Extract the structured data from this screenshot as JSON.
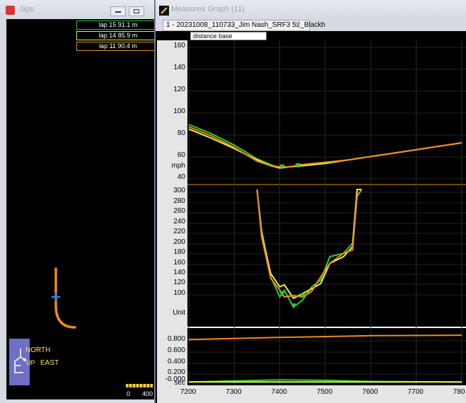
{
  "gps": {
    "title": "Gps",
    "laps": [
      {
        "label": "lap 15 91.1 m",
        "color": "#2ecc2e"
      },
      {
        "label": "lap 14 85.9 m",
        "color": "#e6f04a"
      },
      {
        "label": "lap 11 90.4 m",
        "color": "#f08a1c"
      }
    ],
    "compass": {
      "north": "NORTH",
      "east": "EAST",
      "up": "UP"
    },
    "scale": {
      "start": "0",
      "end": "400"
    }
  },
  "measures": {
    "title": "Measures Graph (11)",
    "tab_label": "1 - 20231008_110733_Jim Nash_SRF3 52_Blackh",
    "tab_close": "✕",
    "distance_label": "distance base"
  },
  "chart_data": [
    {
      "type": "line",
      "ylabel": "mph",
      "ylim": [
        40,
        160
      ],
      "yticks": [
        "160",
        "140",
        "120",
        "100",
        "80",
        "60",
        "40"
      ],
      "series": [
        {
          "name": "lap 15",
          "color": "#2ecc2e",
          "x": [
            7200,
            7250,
            7300,
            7350,
            7380,
            7400,
            7420,
            7450,
            7500,
            7550,
            7600,
            7650,
            7700,
            7750,
            7800
          ],
          "y": [
            90,
            82,
            72,
            60,
            55,
            52,
            53,
            54,
            56,
            59,
            62,
            65,
            68,
            71,
            74
          ]
        },
        {
          "name": "lap 14",
          "color": "#e6f04a",
          "x": [
            7200,
            7250,
            7300,
            7350,
            7380,
            7400,
            7420,
            7450,
            7500,
            7550,
            7600,
            7650,
            7700,
            7750,
            7800
          ],
          "y": [
            86,
            78,
            69,
            59,
            54,
            52,
            53,
            54,
            56,
            59,
            62,
            65,
            68,
            71,
            74
          ]
        },
        {
          "name": "lap 11",
          "color": "#f08a1c",
          "x": [
            7200,
            7250,
            7300,
            7350,
            7380,
            7400,
            7420,
            7450,
            7500,
            7550,
            7600,
            7650,
            7700,
            7750,
            7800
          ],
          "y": [
            88,
            80,
            70,
            58,
            54,
            53,
            53,
            55,
            57,
            59,
            62,
            65,
            68,
            71,
            74
          ]
        }
      ]
    },
    {
      "type": "line",
      "ylabel": "Unit",
      "ylim": [
        100,
        300
      ],
      "yticks": [
        "300",
        "280",
        "260",
        "240",
        "220",
        "200",
        "180",
        "160",
        "140",
        "120",
        "100"
      ],
      "series": [
        {
          "name": "lap 15",
          "color": "#2ecc2e",
          "x": [
            7350,
            7360,
            7380,
            7400,
            7410,
            7430,
            7450,
            7470,
            7490,
            7510,
            7540,
            7560,
            7570,
            7580
          ],
          "y": [
            300,
            240,
            170,
            140,
            150,
            125,
            135,
            155,
            165,
            200,
            205,
            220,
            300,
            300
          ]
        },
        {
          "name": "lap 14",
          "color": "#e6f04a",
          "x": [
            7350,
            7360,
            7380,
            7400,
            7410,
            7430,
            7450,
            7470,
            7490,
            7510,
            7540,
            7560,
            7570,
            7580
          ],
          "y": [
            300,
            235,
            175,
            155,
            158,
            138,
            145,
            152,
            160,
            190,
            200,
            215,
            300,
            300
          ]
        },
        {
          "name": "lap 11",
          "color": "#f08a1c",
          "x": [
            7350,
            7360,
            7380,
            7400,
            7410,
            7430,
            7450,
            7470,
            7490,
            7510,
            7540,
            7560,
            7570,
            7580
          ],
          "y": [
            300,
            230,
            168,
            150,
            140,
            142,
            140,
            148,
            170,
            190,
            205,
            210,
            290,
            300
          ]
        }
      ]
    },
    {
      "type": "line",
      "ylabel": "sec",
      "ylim": [
        -0.01,
        0.9
      ],
      "yticks": [
        "0.800",
        "0.600",
        "0.400",
        "0.200",
        "sec",
        "-0.000"
      ],
      "series": [
        {
          "name": "lap 11",
          "color": "#f08a1c",
          "x": [
            7200,
            7400,
            7600,
            7800
          ],
          "y": [
            0.78,
            0.82,
            0.85,
            0.86
          ]
        },
        {
          "name": "lap 15",
          "color": "#2ecc2e",
          "x": [
            7200,
            7300,
            7400,
            7500,
            7600,
            7800
          ],
          "y": [
            0.0,
            0.02,
            0.04,
            0.03,
            0.01,
            0.0
          ]
        },
        {
          "name": "lap 14",
          "color": "#e6f04a",
          "x": [
            7200,
            7400,
            7600,
            7800
          ],
          "y": [
            0.0,
            0.0,
            0.0,
            0.0
          ]
        }
      ]
    }
  ],
  "x_axis": {
    "ticks": [
      "7200",
      "7300",
      "7400",
      "7500",
      "7600",
      "7700",
      "780"
    ],
    "xlim": [
      7200,
      7800
    ]
  }
}
